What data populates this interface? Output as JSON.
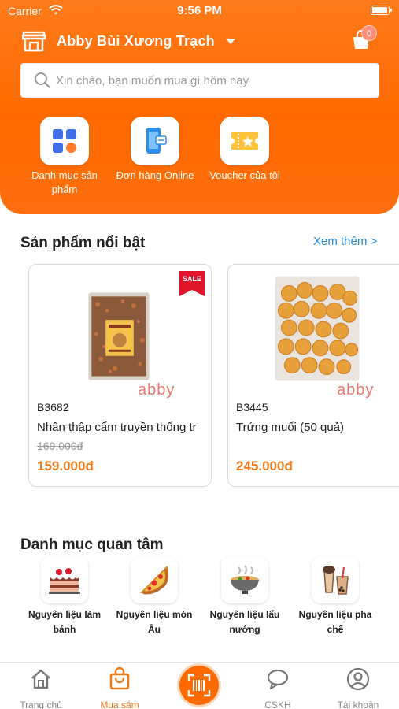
{
  "status_bar": {
    "carrier": "Carrier",
    "time": "9:56 PM"
  },
  "header": {
    "store_name": "Abby Bùi Xương Trạch",
    "cart_count": "0",
    "search_placeholder": "Xin chào, bạn muốn mua gì hôm nay"
  },
  "quick_actions": [
    {
      "label": "Danh mục sản phẩm",
      "icon": "grid-apps-icon"
    },
    {
      "label": "Đơn hàng Online",
      "icon": "phone-order-icon"
    },
    {
      "label": "Voucher của tôi",
      "icon": "voucher-ticket-icon"
    }
  ],
  "featured": {
    "title": "Sản phẩm nổi bật",
    "see_more": "Xem thêm >",
    "products": [
      {
        "code": "B3682",
        "name": "Nhân thập cẩm truyền thống tr",
        "old_price": "169.000đ",
        "price": "159.000đ",
        "badge": "SALE",
        "watermark": "abby"
      },
      {
        "code": "B3445",
        "name": "Trứng muối (50 quả)",
        "old_price": "",
        "price": "245.000đ",
        "badge": "",
        "watermark": "abby"
      }
    ]
  },
  "categories": {
    "title": "Danh mục quan tâm",
    "items": [
      {
        "label": "Nguyên liệu làm bánh",
        "icon": "cake-icon"
      },
      {
        "label": "Nguyên liệu món Âu",
        "icon": "pizza-icon"
      },
      {
        "label": "Nguyên liệu lẩu nướng",
        "icon": "hotpot-icon"
      },
      {
        "label": "Nguyên liệu pha chế",
        "icon": "bubble-tea-icon"
      }
    ]
  },
  "tabbar": {
    "items": [
      {
        "label": "Trang chủ",
        "icon": "home-icon"
      },
      {
        "label": "Mua sắm",
        "icon": "shopping-bag-icon",
        "active": true
      },
      {
        "label": "",
        "icon": "barcode-scan-icon"
      },
      {
        "label": "CSKH",
        "icon": "chat-bubble-icon"
      },
      {
        "label": "Tài khoản",
        "icon": "user-account-icon"
      }
    ]
  },
  "colors": {
    "brand": "#ff6a00",
    "price": "#f07a1a",
    "link": "#2a8bd6"
  }
}
